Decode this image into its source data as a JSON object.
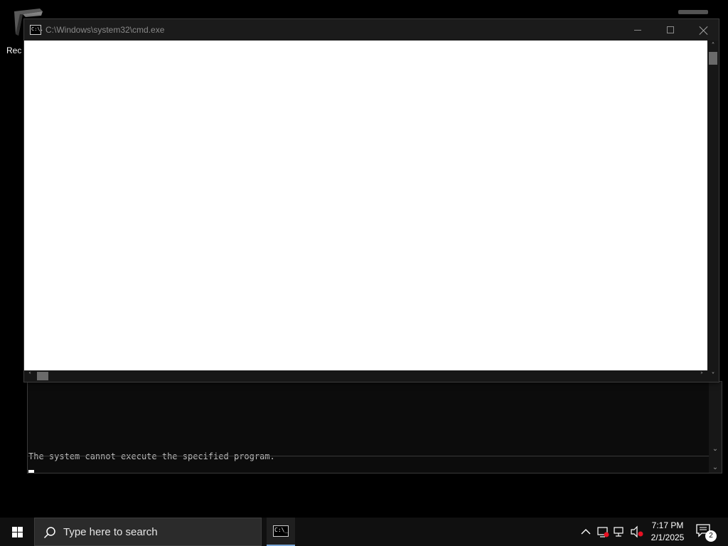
{
  "desktop": {
    "recycle_bin_label": "Rec"
  },
  "cmd_window": {
    "title": "C:\\Windows\\system32\\cmd.exe",
    "icon_text": "C:\\."
  },
  "back_window": {
    "message": "The system cannot execute the specified program."
  },
  "taskbar": {
    "search_placeholder": "Type here to search",
    "cmd_icon_text": "C:\\_",
    "clock_time": "7:17 PM",
    "clock_date": "2/1/2025",
    "notification_count": "2"
  },
  "colors": {
    "client_background": "#ffffff",
    "titlebar": "#1b1b1b",
    "taskbar": "#101010",
    "active_indicator": "#7aa7d8"
  }
}
